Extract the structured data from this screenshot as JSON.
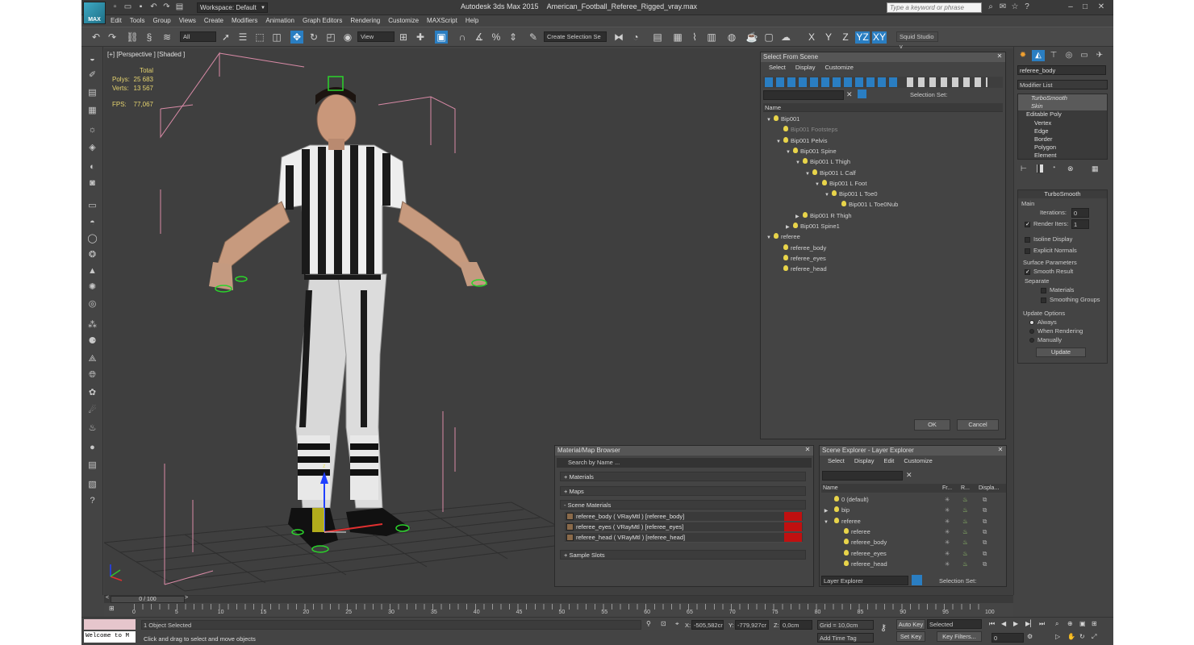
{
  "app": {
    "logo": "MAX",
    "title": "Autodesk 3ds Max  2015",
    "file": "American_Football_Referee_Rigged_vray.max",
    "workspace": "Workspace: Default",
    "search_placeholder": "Type a keyword or phrase"
  },
  "menu": [
    "Edit",
    "Tools",
    "Group",
    "Views",
    "Create",
    "Modifiers",
    "Animation",
    "Graph Editors",
    "Rendering",
    "Customize",
    "MAXScript",
    "Help"
  ],
  "toolbar": {
    "selection_filter": "All",
    "ref_coord": "View",
    "named_selection": "Create Selection Se",
    "squid": "Squid Studio v",
    "axes": [
      "X",
      "Y",
      "Z",
      "YZ",
      "XY"
    ],
    "active_axis": "YZ"
  },
  "viewport": {
    "label": "[+] [Perspective ] [Shaded ]",
    "stats": {
      "header": "Total",
      "polys_label": "Polys:",
      "polys": "25 683",
      "verts_label": "Verts:",
      "verts": "13 567",
      "fps_label": "FPS:",
      "fps": "77,067"
    },
    "axis_z": "z"
  },
  "select_from_scene": {
    "title": "Select From Scene",
    "menu": [
      "Select",
      "Display",
      "Customize"
    ],
    "selection_sets_label": "Selection Set:",
    "column_name": "Name",
    "tree": [
      {
        "label": "Bip001",
        "dim": false
      },
      {
        "label": "Bip001 Footsteps",
        "dim": true
      },
      {
        "label": "Bip001 Pelvis",
        "dim": false
      },
      {
        "label": "Bip001 Spine",
        "dim": false
      },
      {
        "label": "Bip001 L Thigh",
        "dim": false
      },
      {
        "label": "Bip001 L Calf",
        "dim": false
      },
      {
        "label": "Bip001 L Foot",
        "dim": false
      },
      {
        "label": "Bip001 L Toe0",
        "dim": false
      },
      {
        "label": "Bip001 L Toe0Nub",
        "dim": false
      },
      {
        "label": "Bip001 R Thigh",
        "dim": false
      },
      {
        "label": "Bip001 Spine1",
        "dim": false
      },
      {
        "label": "referee",
        "dim": false
      },
      {
        "label": "referee_body",
        "dim": false
      },
      {
        "label": "referee_eyes",
        "dim": false
      },
      {
        "label": "referee_head",
        "dim": false
      }
    ],
    "ok": "OK",
    "cancel": "Cancel"
  },
  "material_browser": {
    "title": "Material/Map Browser",
    "search_placeholder": "Search by Name ...",
    "rollouts": {
      "materials": "+ Materials",
      "maps": "+ Maps",
      "scene_materials": "- Scene Materials",
      "sample_slots": "+ Sample Slots"
    },
    "scene_materials": [
      "referee_body  ( VRayMtl )  [referee_body]",
      "referee_eyes  ( VRayMtl )  [referee_eyes]",
      "referee_head  ( VRayMtl )  [referee_head]"
    ]
  },
  "scene_explorer": {
    "title": "Scene Explorer - Layer Explorer",
    "menu": [
      "Select",
      "Display",
      "Edit",
      "Customize"
    ],
    "columns": [
      "Name",
      "Fr...",
      "R...",
      "Displa..."
    ],
    "rows": [
      "0 (default)",
      "bip",
      "referee",
      "referee",
      "referee_body",
      "referee_eyes",
      "referee_head"
    ],
    "footer_dropdown": "Layer Explorer",
    "footer_sets": "Selection Set:"
  },
  "command_panel": {
    "object_name": "referee_body",
    "modifier_list": "Modifier List",
    "stack": [
      "TurboSmooth",
      "Skin",
      "Editable Poly",
      "Vertex",
      "Edge",
      "Border",
      "Polygon",
      "Element"
    ],
    "turbosmooth": {
      "title": "TurboSmooth",
      "main": "Main",
      "iterations_label": "Iterations:",
      "iterations": "0",
      "render_iters_label": "Render Iters:",
      "render_iters": "1",
      "isoline": "Isoline Display",
      "explicit": "Explicit Normals",
      "surface_params": "Surface Parameters",
      "smooth_result": "Smooth Result",
      "separate": "Separate",
      "materials": "Materials",
      "smoothing_groups": "Smoothing Groups",
      "update_options": "Update Options",
      "always": "Always",
      "when_rendering": "When Rendering",
      "manually": "Manually",
      "update": "Update"
    }
  },
  "timeline": {
    "frame": "0 / 100",
    "ticks": [
      "0",
      "5",
      "10",
      "15",
      "20",
      "25",
      "30",
      "35",
      "40",
      "45",
      "50",
      "55",
      "60",
      "65",
      "70",
      "75",
      "80",
      "85",
      "90",
      "95",
      "100"
    ]
  },
  "status": {
    "listener": "Welcome to M",
    "objects_selected": "1 Object Selected",
    "prompt": "Click and drag to select and move objects",
    "x_label": "X:",
    "x": "-505,582cr",
    "y_label": "Y:",
    "y": "-779,927cr",
    "z_label": "Z:",
    "z": "0,0cm",
    "grid": "Grid = 10,0cm",
    "add_time_tag": "Add Time Tag",
    "auto_key": "Auto Key",
    "set_key": "Set Key",
    "key_mode": "Selected",
    "key_filters": "Key Filters...",
    "current_frame": "0"
  },
  "colors": {
    "accent": "#2a7ec2",
    "bg": "#444444",
    "viewport": "#3f3f3f",
    "material_red": "#c01010"
  }
}
